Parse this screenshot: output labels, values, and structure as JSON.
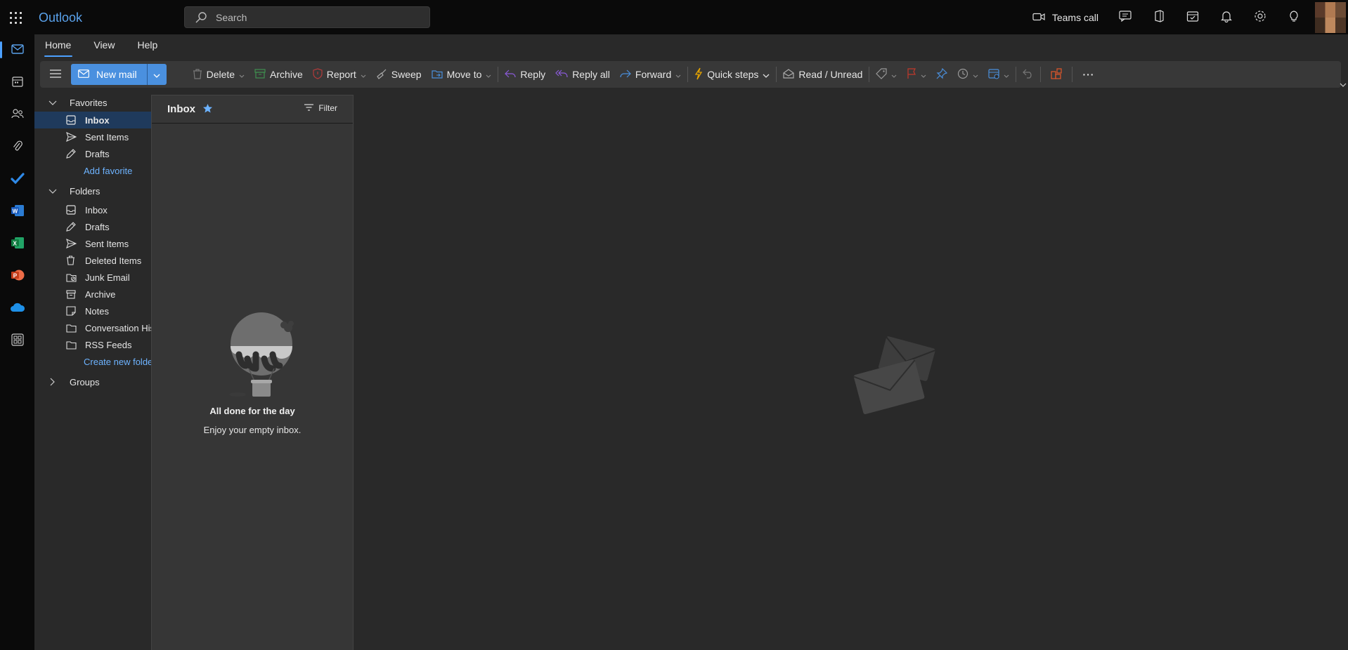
{
  "app": {
    "title": "Outlook"
  },
  "search": {
    "placeholder": "Search"
  },
  "topbar": {
    "teams_call": "Teams call"
  },
  "tabs": [
    {
      "label": "Home"
    },
    {
      "label": "View"
    },
    {
      "label": "Help"
    }
  ],
  "ribbon": {
    "new_mail": "New mail",
    "delete": "Delete",
    "archive": "Archive",
    "report": "Report",
    "sweep": "Sweep",
    "move_to": "Move to",
    "reply": "Reply",
    "reply_all": "Reply all",
    "forward": "Forward",
    "quick_steps": "Quick steps",
    "read_unread": "Read / Unread",
    "more": "···"
  },
  "nav": {
    "favorites": {
      "label": "Favorites",
      "items": [
        {
          "label": "Inbox"
        },
        {
          "label": "Sent Items"
        },
        {
          "label": "Drafts"
        }
      ],
      "add": "Add favorite"
    },
    "folders": {
      "label": "Folders",
      "items": [
        {
          "label": "Inbox"
        },
        {
          "label": "Drafts"
        },
        {
          "label": "Sent Items"
        },
        {
          "label": "Deleted Items"
        },
        {
          "label": "Junk Email"
        },
        {
          "label": "Archive"
        },
        {
          "label": "Notes"
        },
        {
          "label": "Conversation Hist..."
        },
        {
          "label": "RSS Feeds"
        }
      ],
      "create": "Create new folder"
    },
    "groups": {
      "label": "Groups"
    }
  },
  "mail_list": {
    "title": "Inbox",
    "filter": "Filter",
    "empty_title": "All done for the day",
    "empty_subtitle": "Enjoy your empty inbox."
  },
  "colors": {
    "accent": "#4a90df",
    "link": "#6db3ff",
    "selected": "#1f3a5c"
  }
}
